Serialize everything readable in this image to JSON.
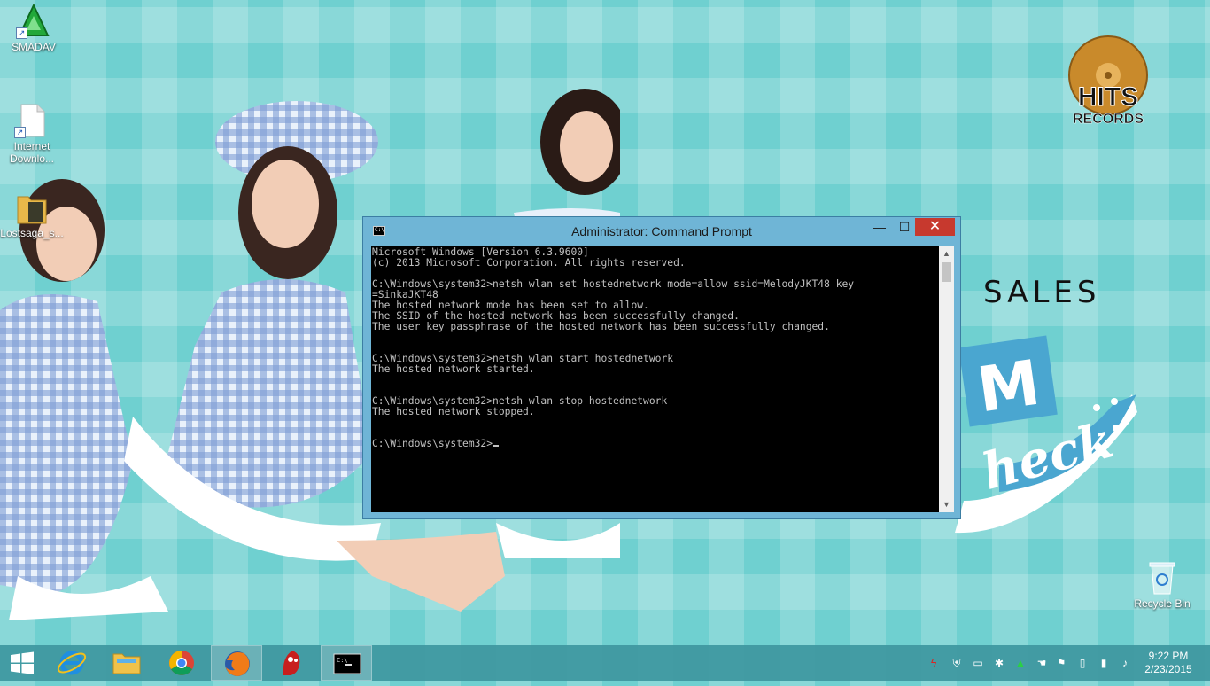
{
  "desktop": {
    "icons": [
      {
        "label": "SMADAV"
      },
      {
        "label": "Internet Downlo..."
      },
      {
        "label": "Lostsaga_s..."
      },
      {
        "label": "Recycle Bin"
      }
    ],
    "wallpaper": {
      "logo_line1": "HITS",
      "logo_line2": "RECORDS",
      "sales_text": "SALES"
    }
  },
  "cmd": {
    "title": "Administrator: Command Prompt",
    "icon_text": "C:\\",
    "controls": {
      "minimize": "—",
      "maximize": "☐",
      "close": "✕"
    },
    "lines": [
      "Microsoft Windows [Version 6.3.9600]",
      "(c) 2013 Microsoft Corporation. All rights reserved.",
      "",
      "C:\\Windows\\system32>netsh wlan set hostednetwork mode=allow ssid=MelodyJKT48 key",
      "=SinkaJKT48",
      "The hosted network mode has been set to allow.",
      "The SSID of the hosted network has been successfully changed.",
      "The user key passphrase of the hosted network has been successfully changed.",
      "",
      "",
      "C:\\Windows\\system32>netsh wlan start hostednetwork",
      "The hosted network started.",
      "",
      "",
      "C:\\Windows\\system32>netsh wlan stop hostednetwork",
      "The hosted network stopped.",
      "",
      ""
    ],
    "prompt": "C:\\Windows\\system32>"
  },
  "taskbar": {
    "buttons": [
      {
        "name": "start-button",
        "icon": "windows-logo-icon"
      },
      {
        "name": "internet-explorer",
        "icon": "internet-explorer-icon"
      },
      {
        "name": "file-explorer",
        "icon": "folder-icon"
      },
      {
        "name": "google-chrome",
        "icon": "chrome-icon"
      },
      {
        "name": "firefox",
        "icon": "firefox-icon"
      },
      {
        "name": "app-red",
        "icon": "red-app-icon"
      },
      {
        "name": "command-prompt",
        "icon": "cmd-icon"
      }
    ],
    "clock": {
      "time": "9:22 PM",
      "date": "2/23/2015"
    }
  },
  "colors": {
    "desktop_bg": "#6fd0d0",
    "window_frame": "#6fb5d6",
    "close_button": "#c7392e",
    "console_bg": "#000000",
    "console_text": "#c0c0c0"
  }
}
